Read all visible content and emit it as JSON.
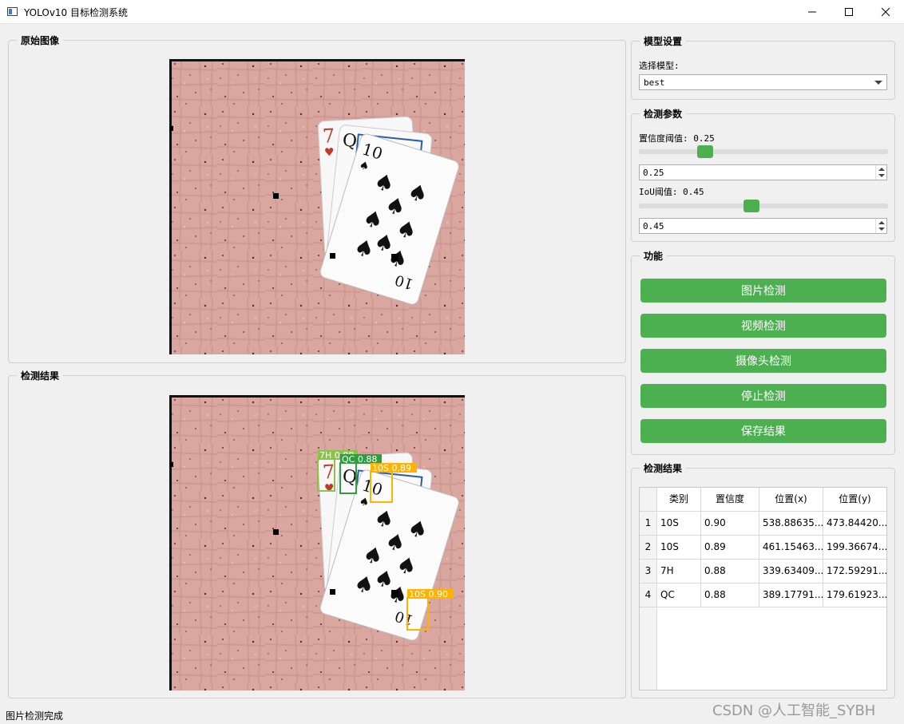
{
  "window": {
    "title": "YOLOv10 目标检测系统",
    "icon": "app-window-icon"
  },
  "original_panel": {
    "title": "原始图像"
  },
  "result_panel": {
    "title": "检测结果"
  },
  "detections": [
    {
      "label": "7H 0.88",
      "color": "#8bc34a"
    },
    {
      "label": "QC 0.88",
      "color": "#2e9e3e"
    },
    {
      "label": "10S 0.89",
      "color": "#ffb300"
    },
    {
      "label": "10S 0.90",
      "color": "#ffb300"
    }
  ],
  "model_settings": {
    "title": "模型设置",
    "select_label": "选择模型:",
    "selected_model": "best"
  },
  "detection_params": {
    "title": "检测参数",
    "conf_label": "置信度阈值: 0.25",
    "conf_value": "0.25",
    "conf_level": 0.25,
    "iou_label": "IoU阈值: 0.45",
    "iou_value": "0.45",
    "iou_level": 0.45,
    "slider_color": "#4caf50"
  },
  "functions": {
    "title": "功能",
    "buttons": [
      "图片检测",
      "视频检测",
      "摄像头检测",
      "停止检测",
      "保存结果"
    ],
    "button_color": "#4caf50"
  },
  "results_table": {
    "title": "检测结果",
    "headers": [
      "类别",
      "置信度",
      "位置(x)",
      "位置(y)"
    ],
    "rows": [
      {
        "index": "1",
        "class": "10S",
        "conf": "0.90",
        "x": "538.88635...",
        "y": "473.84420..."
      },
      {
        "index": "2",
        "class": "10S",
        "conf": "0.89",
        "x": "461.15463...",
        "y": "199.36674..."
      },
      {
        "index": "3",
        "class": "7H",
        "conf": "0.88",
        "x": "339.63409...",
        "y": "172.59291..."
      },
      {
        "index": "4",
        "class": "QC",
        "conf": "0.88",
        "x": "389.17791...",
        "y": "179.61923..."
      }
    ]
  },
  "status_bar": {
    "text": "图片检测完成"
  },
  "watermark": {
    "text": "CSDN @人工智能_SYBH"
  }
}
